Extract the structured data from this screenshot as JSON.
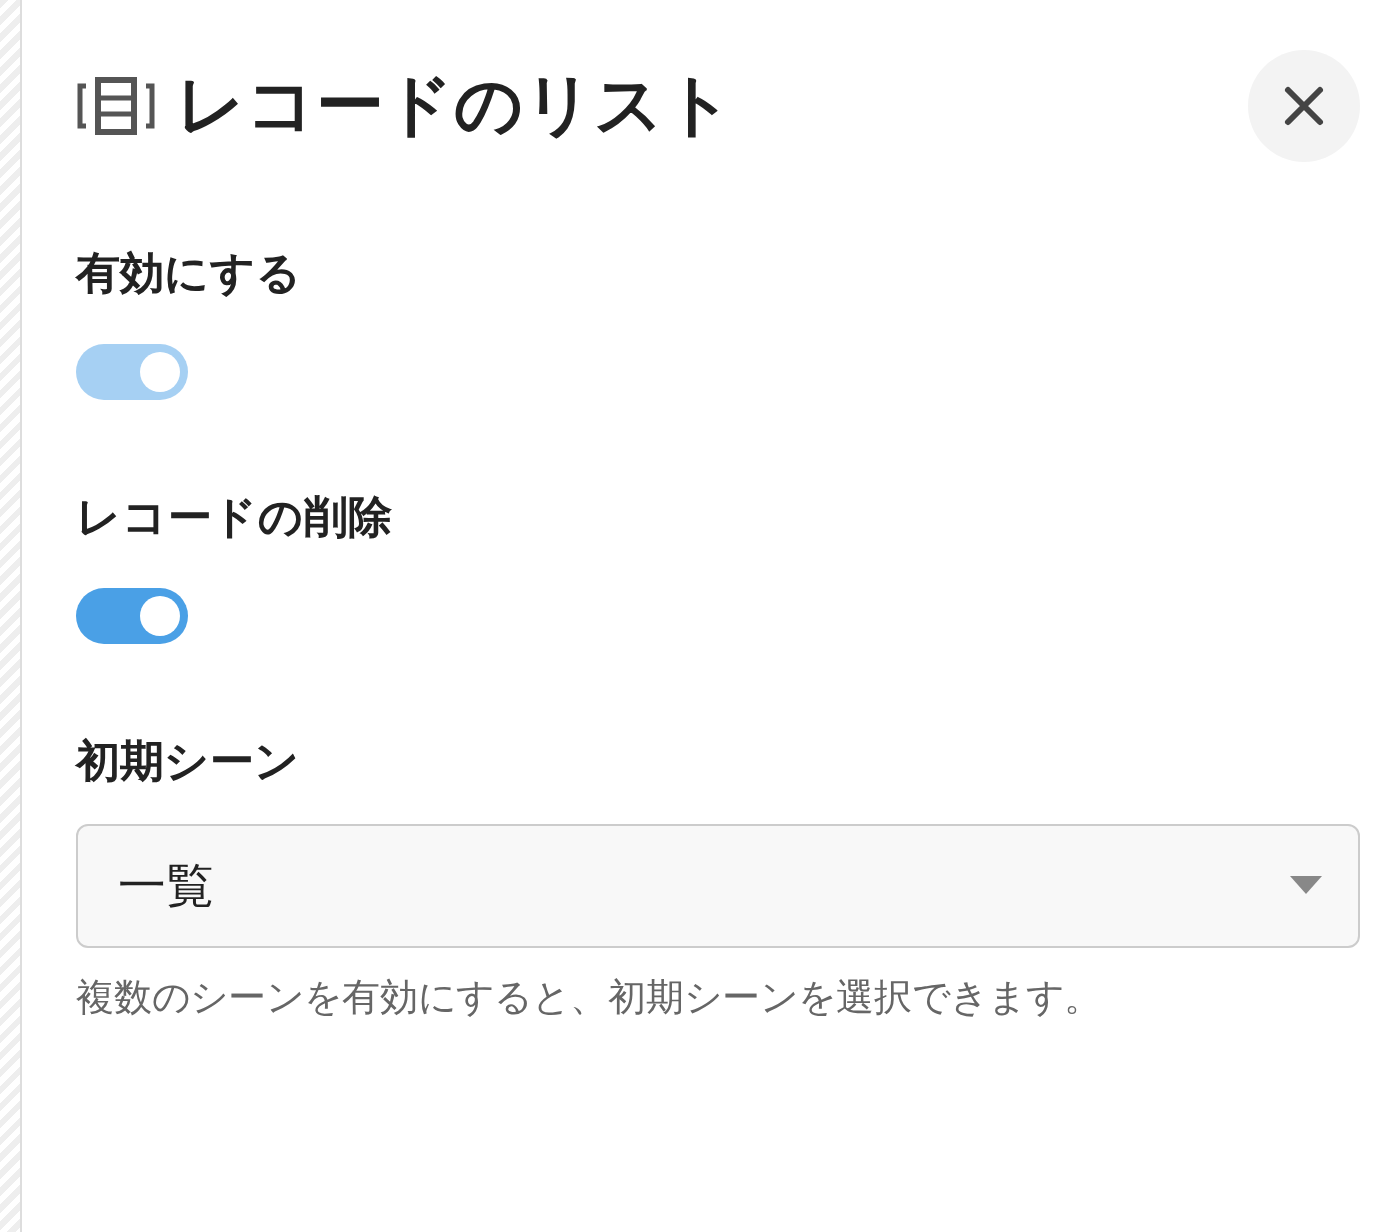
{
  "panel": {
    "title": "レコードのリスト"
  },
  "settings": [
    {
      "kind": "toggle",
      "label": "有効にする",
      "on": true,
      "disabled": true
    },
    {
      "kind": "toggle",
      "label": "レコードの削除",
      "on": true,
      "disabled": false
    },
    {
      "kind": "select",
      "label": "初期シーン",
      "value": "一覧",
      "help": "複数のシーンを有効にすると、初期シーンを選択できます。"
    }
  ]
}
